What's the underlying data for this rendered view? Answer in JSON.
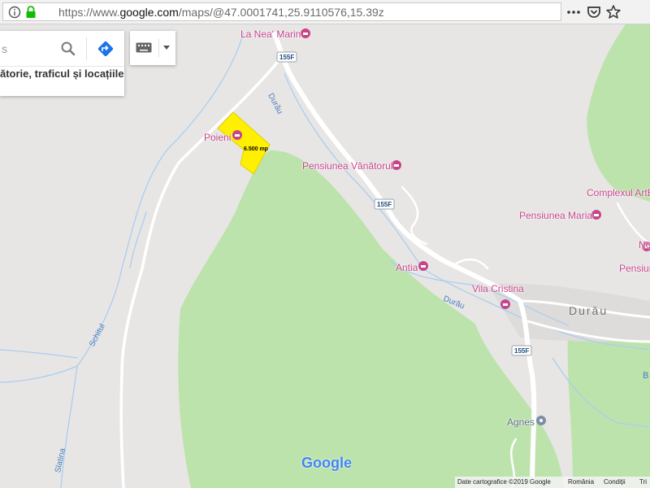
{
  "browser": {
    "url_prefix": "https://www.",
    "url_domain": "google.com",
    "url_path": "/maps/@47.0001741,25.9110576,15.39z",
    "info_icon": "info-icon",
    "lock_icon": "lock-icon",
    "menu_icon": "ellipsis-icon",
    "pocket_icon": "pocket-icon",
    "bookmark_icon": "star-icon"
  },
  "search": {
    "placeholder_tail": "s",
    "subtitle": "ătorie, traficul și locațiile",
    "search_icon": "search-icon",
    "directions_icon": "directions-icon",
    "keyboard_icon": "keyboard-icon",
    "dropdown_icon": "caret-down-icon"
  },
  "map": {
    "colors": {
      "forest": "#bde3ad",
      "land": "#e8e6e4",
      "road": "#ffffff",
      "water": "#a9cdf1",
      "poi": "#c6458b",
      "parcel": "#ffef00"
    },
    "places": [
      {
        "label": "La Nea' Marin"
      },
      {
        "label": "Poieni"
      },
      {
        "label": "Pensiunea Vânătorul"
      },
      {
        "label": "Complexul ArtE"
      },
      {
        "label": "Pensiunea Maria"
      },
      {
        "label": "No"
      },
      {
        "label": "Pensiun"
      },
      {
        "label": "Antia"
      },
      {
        "label": "Vila Cristina"
      },
      {
        "label": "Agnes"
      }
    ],
    "town": "Durău",
    "streams": [
      "Durău",
      "Durău",
      "Schitul",
      "Slatina"
    ],
    "route_badges": [
      "155F",
      "155F",
      "155F"
    ],
    "parcel_label": "6.500 mp",
    "edge_label": "B",
    "logo": "Google"
  },
  "footer": {
    "attribution": "Date cartografice ©2019 Google",
    "region": "România",
    "terms": "Condiții",
    "more": "Tri"
  }
}
